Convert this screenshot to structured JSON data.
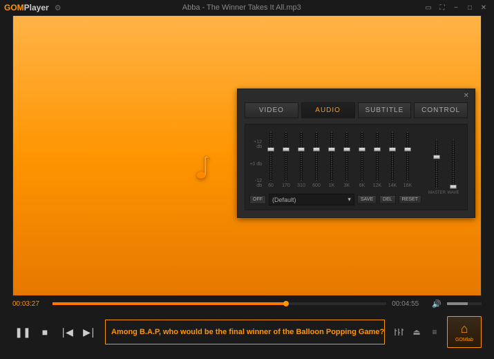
{
  "titlebar": {
    "logo_gom": "GOM",
    "logo_player": "Player",
    "title": "Abba - The Winner Takes It All.mp3"
  },
  "panel": {
    "tabs": [
      "VIDEO",
      "AUDIO",
      "SUBTITLE",
      "CONTROL"
    ],
    "active_tab": 1,
    "eq": {
      "scale": [
        "+12 db",
        "+0 db",
        "-12 db"
      ],
      "bands": [
        {
          "label": "60",
          "pos": 48
        },
        {
          "label": "170",
          "pos": 48
        },
        {
          "label": "310",
          "pos": 48
        },
        {
          "label": "600",
          "pos": 48
        },
        {
          "label": "1K",
          "pos": 48
        },
        {
          "label": "3K",
          "pos": 48
        },
        {
          "label": "6K",
          "pos": 48
        },
        {
          "label": "12K",
          "pos": 48
        },
        {
          "label": "14K",
          "pos": 48
        },
        {
          "label": "16K",
          "pos": 48
        }
      ],
      "off_label": "OFF",
      "preset": "(Default)",
      "save_label": "SAVE",
      "del_label": "DEL",
      "reset_label": "RESET",
      "master": {
        "label": "MASTER",
        "pos": 48
      },
      "wave": {
        "label": "WAVE",
        "pos": 5
      }
    }
  },
  "playback": {
    "current": "00:03:27",
    "total": "00:04:55",
    "progress_pct": 70,
    "volume_pct": 60
  },
  "ticker": "Among B.A.P, who would be the final winner of the Balloon Popping Game? Che",
  "gomlab": "GOMlab"
}
